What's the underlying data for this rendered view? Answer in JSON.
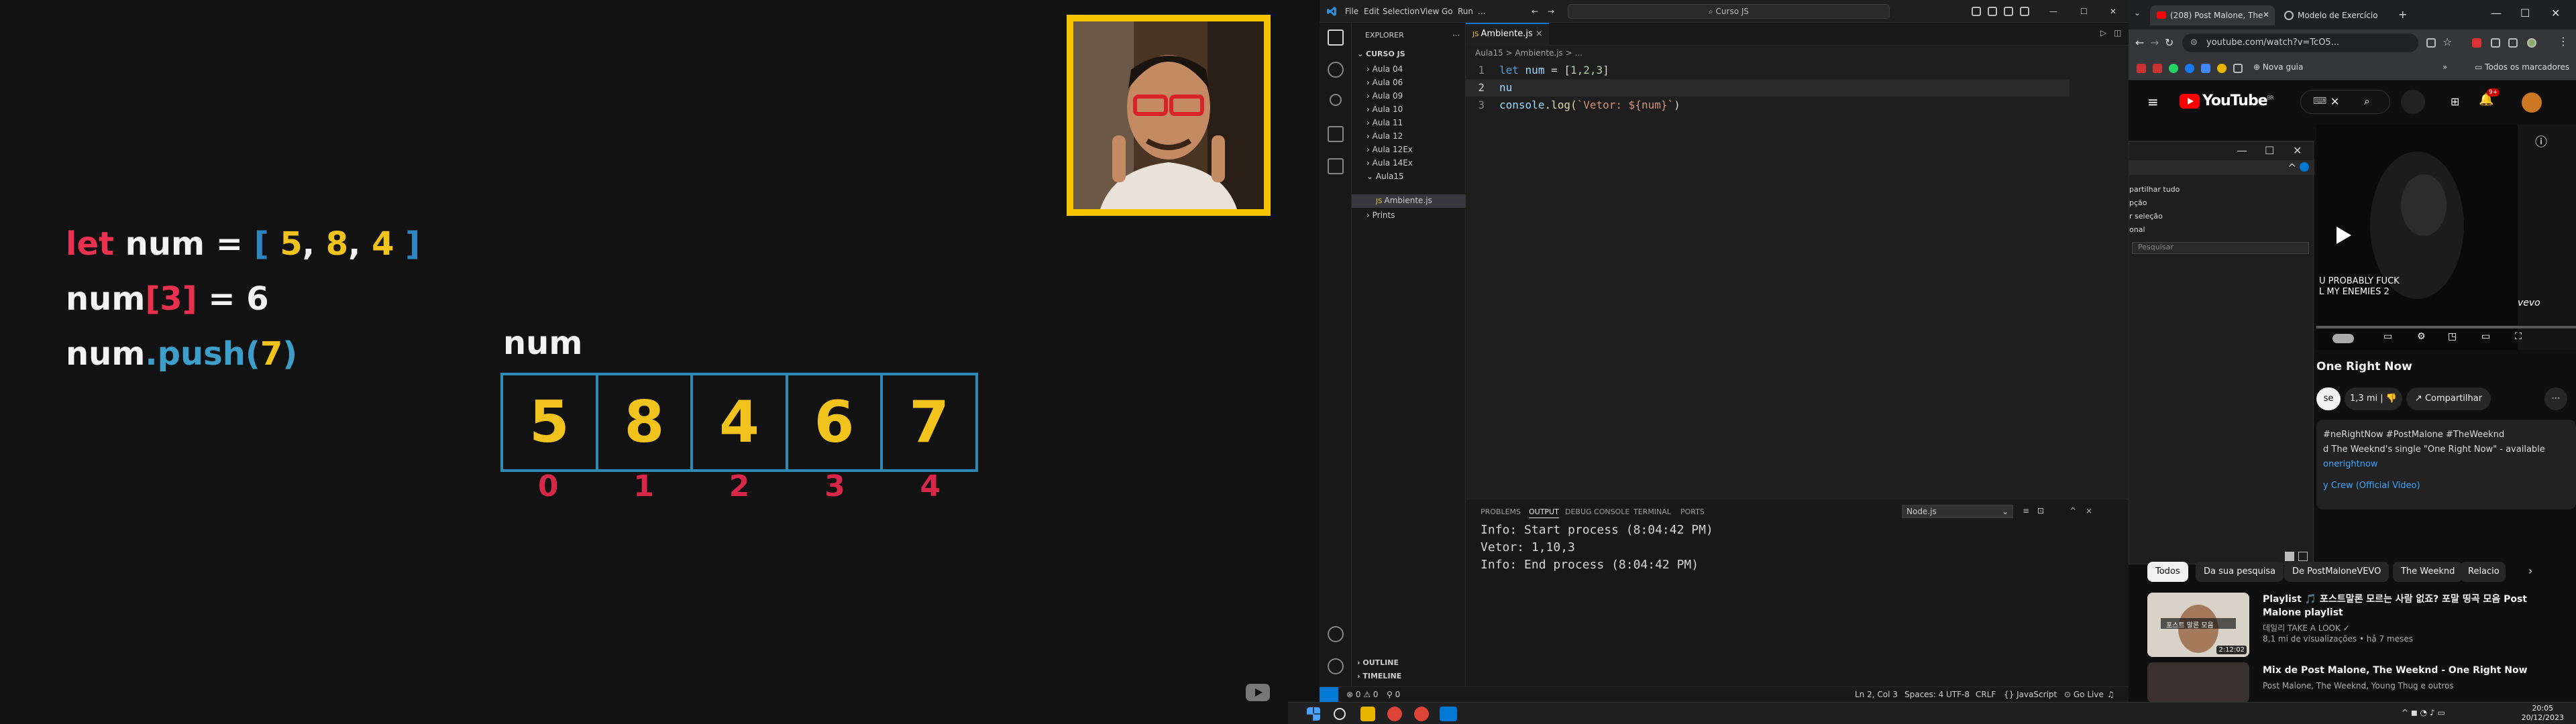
{
  "slide": {
    "line1": {
      "kw": "let",
      "name": "num",
      "eq": "=",
      "open": "[",
      "v1": "5",
      "v2": "8",
      "v3": "4",
      "close": "]"
    },
    "line2": {
      "name": "num",
      "open": "[",
      "index": "3",
      "close": "]",
      "eq": "= 6"
    },
    "line3": {
      "name": "num",
      "method": ".push(",
      "arg": "7",
      "close": ")"
    },
    "array_label": "num",
    "cells": [
      "5",
      "8",
      "4",
      "6",
      "7"
    ],
    "indexes": [
      "0",
      "1",
      "2",
      "3",
      "4"
    ]
  },
  "vscode": {
    "menu": [
      "File",
      "Edit",
      "Selection",
      "View",
      "Go",
      "Run",
      "..."
    ],
    "search": "Curso JS",
    "explorer_title": "EXPLORER",
    "folder": "CURSO JS",
    "tree": [
      "Aula 04",
      "Aula 06",
      "Aula 09",
      "Aula 10",
      "Aula 11",
      "Aula 12",
      "Aula 12Ex",
      "Aula 14Ex",
      "Aula15",
      "Ambiente.js",
      "Prints"
    ],
    "outline": "OUTLINE",
    "timeline": "TIMELINE",
    "tab": "Ambiente.js",
    "breadcrumb": "Aula15 > Ambiente.js > ...",
    "code": {
      "l1_kw": "let",
      "l1_var": "num",
      "l1_rest": " = [",
      "l1_nums": "1,2,3",
      "l1_end": "]",
      "l2": "nu",
      "l3_obj": "console",
      "l3_fn": ".log(",
      "l3_str": "`Vetor: ${num}`",
      "l3_end": ")"
    },
    "panel_tabs": [
      "PROBLEMS",
      "OUTPUT",
      "DEBUG CONSOLE",
      "TERMINAL",
      "PORTS"
    ],
    "panel_select": "Node.js",
    "output": [
      "Info: Start process (8:04:42 PM)",
      "Vetor: 1,10,3",
      "Info: End process (8:04:42 PM)"
    ],
    "status": {
      "errors": "0",
      "warnings": "0",
      "ports": "0",
      "position": "Ln 2, Col 3",
      "spaces": "Spaces: 4",
      "encoding": "UTF-8",
      "eol": "CRLF",
      "language": "{} JavaScript",
      "golive": "Go Live"
    }
  },
  "chrome": {
    "tab1": "(208) Post Malone, The",
    "tab2": "Modelo de Exercício",
    "url": "youtube.com/watch?v=TcO5...",
    "bookmark_newtab": "Nova guia",
    "bookmarks_all": "Todos os marcadores",
    "yt_logo": "YouTube",
    "yt_logo_sup": "BR",
    "overlay_text": [
      "U PROBABLY FUCK",
      "L MY ENEMIES 2"
    ],
    "vevo": "vevo",
    "video_title": "One Right Now",
    "subscribe": "se",
    "likes": "1,3 mi",
    "share": "Compartilhar",
    "desc_lines": [
      "#neRightNow #PostMalone #TheWeeknd",
      "d The Weeknd's single \"One Right Now\" - available",
      "onerightnow",
      "y Crew (Official Video)"
    ],
    "dialog_items": [
      "partilhar tudo",
      "pção",
      "r seleção",
      "onal",
      "Pesquisar"
    ],
    "chips": [
      "Todos",
      "Da sua pesquisa",
      "De PostMaloneVEVO",
      "The Weeknd",
      "Relacio"
    ],
    "rec": [
      {
        "title": "Playlist 🎵 포스트말론 모르는 사람 없죠? 포말 띵곡 모음 Post Malone playlist",
        "channel": "데일리 TAKE A LOOK ✓",
        "meta": "8,1 mi de visualizações • há 7 meses",
        "duration": "2:12:02",
        "thumb_text": "포스트 말론 모음"
      },
      {
        "title": "Mix de Post Malone, The Weeknd - One Right Now",
        "channel": "Post Malone, The Weeknd, Young Thug e outros",
        "meta": "",
        "duration": "",
        "thumb_text": ""
      }
    ]
  },
  "taskbar": {
    "time": "20:05",
    "date": "20/12/2023"
  }
}
